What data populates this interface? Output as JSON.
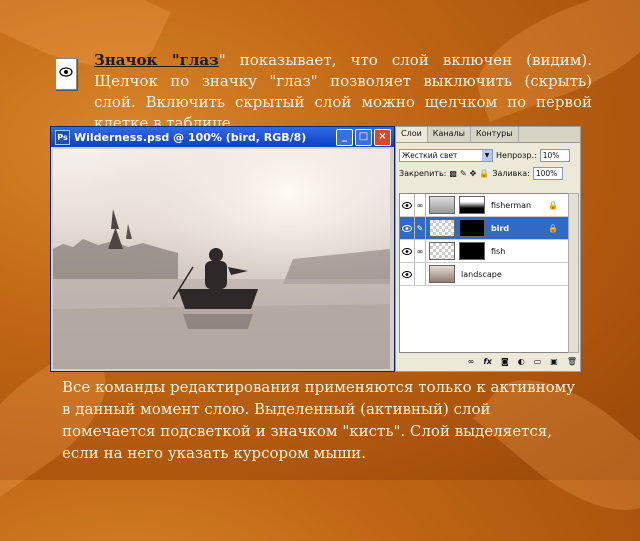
{
  "slide": {
    "intro_bold": "Значок \"глаз",
    "intro_rest": "\" показывает, что слой включен (видим). Щелчок по значку \"глаз\" позволяет выключить (скрыть) слой. Включить скрытый слой можно щелчком по первой клетке в таблице.",
    "bottom": "Все команды редактирования применяются только к активному в данный момент слою. Выделенный (активный) слой помечается подсветкой и значком \"кисть\". Слой выделяется, если на него указать курсором мыши."
  },
  "image_window": {
    "title": "Wilderness.psd @ 100% (bird, RGB/8)",
    "app_icon": "Ps",
    "minimize": "_",
    "maximize": "□",
    "close": "×"
  },
  "layers_panel": {
    "tabs": [
      "Слои",
      "Каналы",
      "Контуры"
    ],
    "blend_mode": "Жесткий свет",
    "opacity_label": "Непрозр.:",
    "opacity_value": "10%",
    "lock_label": "Закрепить:",
    "fill_label": "Заливка:",
    "fill_value": "100%",
    "layers": [
      {
        "name": "fisherman",
        "active": false,
        "has_mask": true,
        "locked": true
      },
      {
        "name": "bird",
        "active": true,
        "has_mask": true,
        "locked": true
      },
      {
        "name": "fish",
        "active": false,
        "has_mask": true,
        "locked": false
      },
      {
        "name": "landscape",
        "active": false,
        "has_mask": false,
        "locked": false
      }
    ],
    "footer_icons": [
      "link-icon",
      "fx-icon",
      "mask-icon",
      "adjustment-icon",
      "folder-icon",
      "new-layer-icon",
      "trash-icon"
    ],
    "footer_glyphs": [
      "∞",
      "fx",
      "◙",
      "◐",
      "▭",
      "▣",
      "🗑"
    ]
  }
}
